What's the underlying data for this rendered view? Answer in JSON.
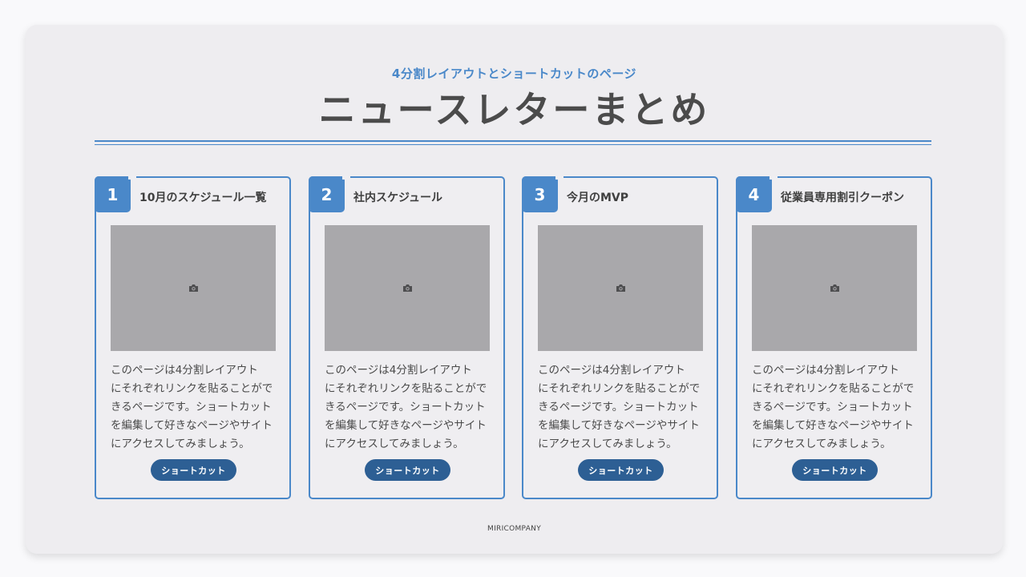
{
  "header": {
    "subtitle": "4分割レイアウトとショートカットのページ",
    "title": "ニュースレターまとめ"
  },
  "cards": [
    {
      "number": "1",
      "title": "10月のスケジュール一覧",
      "description": "このページは4分割レイアウト　にそれぞれリンクを貼ることができるページです。ショートカットを編集して好きなページやサイトにアクセスしてみましょう。",
      "button_label": "ショートカット",
      "image_icon": "camera-icon"
    },
    {
      "number": "2",
      "title": "社内スケジュール",
      "description": "このページは4分割レイアウト　にそれぞれリンクを貼ることができるページです。ショートカットを編集して好きなページやサイトにアクセスしてみましょう。",
      "button_label": "ショートカット",
      "image_icon": "camera-icon"
    },
    {
      "number": "3",
      "title": "今月のMVP",
      "description": "このページは4分割レイアウト　にそれぞれリンクを貼ることができるページです。ショートカットを編集して好きなページやサイトにアクセスしてみましょう。",
      "button_label": "ショートカット",
      "image_icon": "camera-icon"
    },
    {
      "number": "4",
      "title": "従業員専用割引クーポン",
      "description": "このページは4分割レイアウト　にそれぞれリンクを貼ることができるページです。ショートカットを編集して好きなページやサイトにアクセスしてみましょう。",
      "button_label": "ショートカット",
      "image_icon": "camera-icon"
    }
  ],
  "footer": {
    "company": "MIRICOMPANY"
  },
  "colors": {
    "accent": "#4a88c9",
    "button": "#2d5f94",
    "panel": "#eeedf0",
    "image_placeholder": "#a9a8ab"
  }
}
